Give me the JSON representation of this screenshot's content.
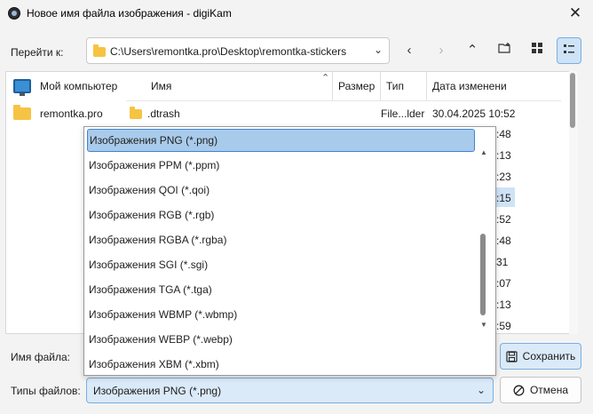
{
  "window": {
    "title": "Новое имя файла изображения - digiKam"
  },
  "toolbar": {
    "goto_label": "Перейти к:",
    "path": "C:\\Users\\remontka.pro\\Desktop\\remontka-stickers"
  },
  "places": [
    {
      "label": "Мой компьютер",
      "icon": "computer-icon"
    },
    {
      "label": "remontka.pro",
      "icon": "folder-icon"
    }
  ],
  "file_list": {
    "columns": [
      "Имя",
      "Размер",
      "Тип",
      "Дата изменени"
    ],
    "rows": [
      {
        "name": ".dtrash",
        "size": "",
        "type": "File...lder",
        "date": "30.04.2025 10:52"
      }
    ],
    "partial_times": [
      ":48",
      ":13",
      ":23",
      ":15",
      ":52",
      ":48",
      "31",
      ":07",
      ":13",
      ":59",
      ":13"
    ]
  },
  "form": {
    "filename_label": "Имя файла:",
    "filetype_label": "Типы файлов:",
    "filetype_value": "Изображения PNG (*.png)"
  },
  "buttons": {
    "save": "Сохранить",
    "cancel": "Отмена"
  },
  "dropdown": {
    "options": [
      "Изображения PNG (*.png)",
      "Изображения PPM (*.ppm)",
      "Изображения QOI (*.qoi)",
      "Изображения RGB (*.rgb)",
      "Изображения RGBA (*.rgba)",
      "Изображения SGI (*.sgi)",
      "Изображения TGA (*.tga)",
      "Изображения WBMP (*.wbmp)",
      "Изображения WEBP (*.webp)",
      "Изображения XBM (*.xbm)"
    ],
    "selected_index": 0
  },
  "colors": {
    "accent": "#3f86cf",
    "selection": "#a9cbeb",
    "folder": "#f6c343"
  }
}
